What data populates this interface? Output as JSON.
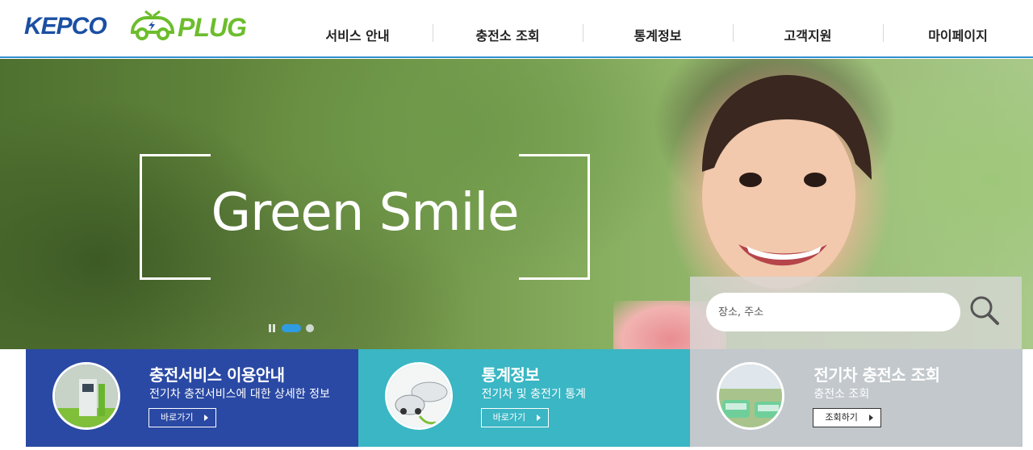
{
  "brand": {
    "logo_left": "KEPCO",
    "logo_right": "PLUG"
  },
  "nav": {
    "items": [
      {
        "label": "서비스 안내"
      },
      {
        "label": "충전소 조회"
      },
      {
        "label": "통계정보"
      },
      {
        "label": "고객지원"
      },
      {
        "label": "마이페이지"
      }
    ]
  },
  "hero": {
    "title": "Green Smile",
    "slides": {
      "total": 2,
      "active": 1
    }
  },
  "search": {
    "placeholder": "장소, 주소"
  },
  "boxes": [
    {
      "title": "충전서비스 이용안내",
      "desc": "전기차 충전서비스에 대한 상세한 정보",
      "button": "바로가기"
    },
    {
      "title": "통계정보",
      "desc": "전기차 및 충전기 통계",
      "button": "바로가기"
    },
    {
      "title": "전기차 충전소 조회",
      "desc": "충전소 조회",
      "button": "조회하기"
    }
  ],
  "colors": {
    "brand_blue": "#1b4fa3",
    "brand_green": "#6cbd2c",
    "box1": "#2a49a4",
    "box2": "#3ab6c4",
    "box3": "#c2c8cc",
    "slider_active": "#2f9be0"
  },
  "icons": {
    "search": "search-icon",
    "play": "chevron-right-icon",
    "pause": "pause-icon"
  }
}
